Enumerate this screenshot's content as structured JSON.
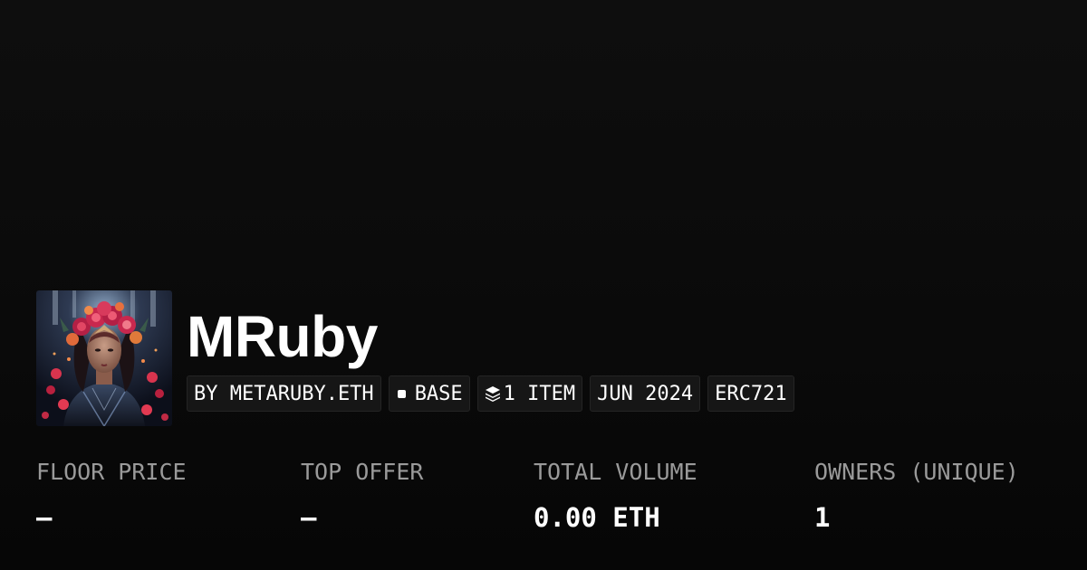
{
  "collection": {
    "name": "MRuby",
    "avatar_icon": "collection-portrait-image"
  },
  "chips": {
    "creator": "BY METARUBY.ETH",
    "chain": "BASE",
    "chain_icon": "square-dot-icon",
    "items": "1 ITEM",
    "items_icon": "layers-icon",
    "date": "JUN 2024",
    "standard": "ERC721"
  },
  "stats": {
    "floor_price": {
      "label": "FLOOR PRICE",
      "value": "–"
    },
    "top_offer": {
      "label": "TOP OFFER",
      "value": "–"
    },
    "total_volume": {
      "label": "TOTAL VOLUME",
      "value": "0.00 ETH"
    },
    "owners": {
      "label": "OWNERS (UNIQUE)",
      "value": "1"
    }
  },
  "colors": {
    "background": "#0a0a0a",
    "text": "#ffffff",
    "muted": "#9a9a9a",
    "chip_bg": "#161616"
  }
}
